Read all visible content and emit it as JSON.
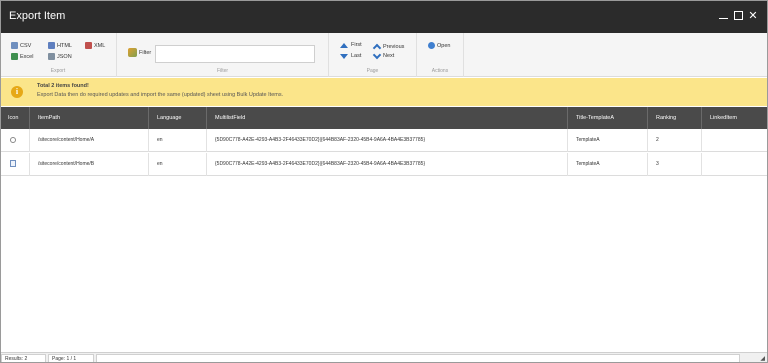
{
  "window": {
    "title": "Export Item",
    "controls": [
      "minimize-icon",
      "maximize-icon",
      "close-icon"
    ],
    "close_glyph": "✕"
  },
  "ribbon": {
    "export": {
      "label": "Export",
      "buttons": [
        {
          "label": "CSV",
          "icon": "csv-icon"
        },
        {
          "label": "Excel",
          "icon": "excel-icon"
        },
        {
          "label": "HTML",
          "icon": "html-icon"
        },
        {
          "label": "JSON",
          "icon": "json-icon"
        },
        {
          "label": "XML",
          "icon": "xml-icon"
        }
      ]
    },
    "filter": {
      "label": "Filter",
      "button_label": "Filter",
      "input_value": "",
      "input_placeholder": ""
    },
    "page": {
      "label": "Page",
      "buttons": [
        {
          "label": "First",
          "icon": "double-up-icon"
        },
        {
          "label": "Last",
          "icon": "double-down-icon"
        },
        {
          "label": "Previous",
          "icon": "chevron-up-icon"
        },
        {
          "label": "Next",
          "icon": "chevron-down-icon"
        }
      ]
    },
    "actions": {
      "label": "Actions",
      "buttons": [
        {
          "label": "Open",
          "icon": "open-icon"
        }
      ]
    }
  },
  "notice": {
    "icon_glyph": "i",
    "title": "Total 2 items found!",
    "text": "Export Data then do required updates and import the same (updated) sheet using Bulk Update Items.",
    "color": "#fbe58a"
  },
  "grid": {
    "columns": [
      "Icon",
      "ItemPath",
      "Language",
      "MultilistField",
      "Title-TemplateA",
      "Ranking",
      "LinkedItem"
    ],
    "rows": [
      {
        "icon": "gear-icon",
        "item_path": "/sitecore/content/Home/A",
        "language": "en",
        "multilist": "{5D90C778-A42E-4293-A4B3-2F46433E70D2}|{644B83AF-2320-45B4-9A6A-4BA4E3B37785}",
        "title": "TemplateA",
        "ranking": "2",
        "linked": ""
      },
      {
        "icon": "document-icon",
        "item_path": "/sitecore/content/Home/B",
        "language": "en",
        "multilist": "{5D90C778-A42E-4293-A4B3-2F46433E70D2}|{644B83AF-2320-45B4-9A6A-4BA4E3B37785}",
        "title": "TemplateA",
        "ranking": "3",
        "linked": ""
      }
    ]
  },
  "footer": {
    "results": "Results: 2",
    "page": "Page: 1 / 1",
    "status": ""
  }
}
